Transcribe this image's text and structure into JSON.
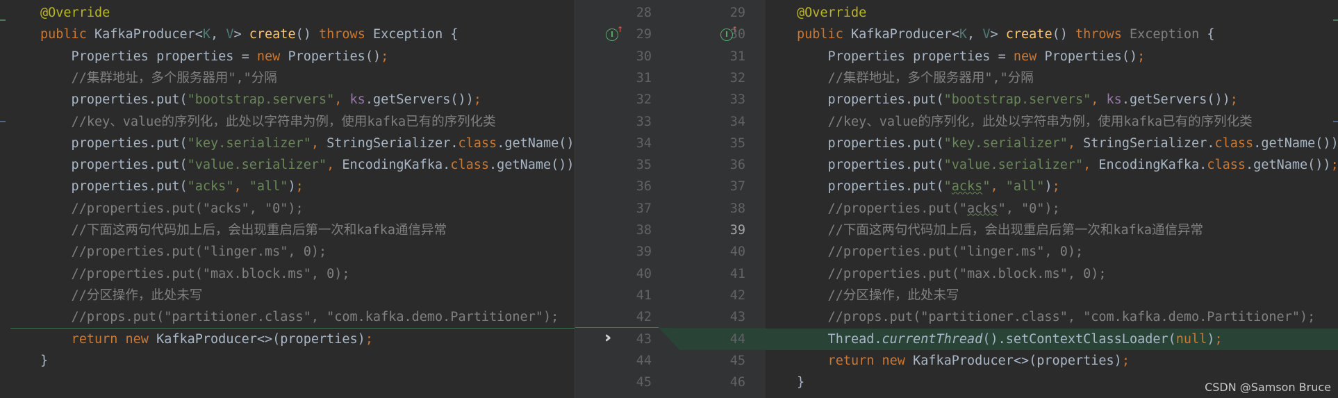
{
  "left": {
    "lines": [
      {
        "segs": [
          {
            "c": "ann",
            "t": "@Override"
          }
        ]
      },
      {
        "segs": [
          {
            "c": "kw",
            "t": "public "
          },
          {
            "c": "",
            "t": "KafkaProducer<"
          },
          {
            "c": "tp",
            "t": "K"
          },
          {
            "c": "",
            "t": ", "
          },
          {
            "c": "tp",
            "t": "V"
          },
          {
            "c": "",
            "t": "> "
          },
          {
            "c": "fn",
            "t": "create"
          },
          {
            "c": "",
            "t": "() "
          },
          {
            "c": "kw",
            "t": "throws "
          },
          {
            "c": "",
            "t": "Exception {"
          }
        ]
      },
      {
        "segs": [
          {
            "c": "",
            "t": "    Properties properties = "
          },
          {
            "c": "kw",
            "t": "new "
          },
          {
            "c": "",
            "t": "Properties()"
          },
          {
            "c": "kw",
            "t": ";"
          }
        ]
      },
      {
        "segs": [
          {
            "c": "cm",
            "t": "    //集群地址，多个服务器用\",\"分隔"
          }
        ]
      },
      {
        "segs": [
          {
            "c": "",
            "t": "    properties.put("
          },
          {
            "c": "str",
            "t": "\"bootstrap.servers\""
          },
          {
            "c": "kw",
            "t": ", "
          },
          {
            "c": "fld",
            "t": "ks"
          },
          {
            "c": "",
            "t": ".getServers())"
          },
          {
            "c": "kw",
            "t": ";"
          }
        ]
      },
      {
        "segs": [
          {
            "c": "cm",
            "t": "    //key、value的序列化，此处以字符串为例，使用kafka已有的序列化类"
          }
        ]
      },
      {
        "segs": [
          {
            "c": "",
            "t": "    properties.put("
          },
          {
            "c": "str",
            "t": "\"key.serializer\""
          },
          {
            "c": "kw",
            "t": ", "
          },
          {
            "c": "",
            "t": "StringSerializer."
          },
          {
            "c": "kw",
            "t": "class"
          },
          {
            "c": "",
            "t": ".getName())"
          }
        ]
      },
      {
        "segs": [
          {
            "c": "",
            "t": "    properties.put("
          },
          {
            "c": "str",
            "t": "\"value.serializer\""
          },
          {
            "c": "kw",
            "t": ", "
          },
          {
            "c": "",
            "t": "EncodingKafka."
          },
          {
            "c": "kw",
            "t": "class"
          },
          {
            "c": "",
            "t": ".getName())"
          },
          {
            "c": "kw",
            "t": ";"
          }
        ]
      },
      {
        "segs": [
          {
            "c": "",
            "t": "    properties.put("
          },
          {
            "c": "str",
            "t": "\"acks\""
          },
          {
            "c": "kw",
            "t": ", "
          },
          {
            "c": "str",
            "t": "\"all\""
          },
          {
            "c": "",
            "t": ")"
          },
          {
            "c": "kw",
            "t": ";"
          }
        ]
      },
      {
        "segs": [
          {
            "c": "cm",
            "t": "    //properties.put(\"acks\", \"0\");"
          }
        ]
      },
      {
        "segs": [
          {
            "c": "cm",
            "t": "    //下面这两句代码加上后，会出现重启后第一次和kafka通信异常"
          }
        ]
      },
      {
        "segs": [
          {
            "c": "cm",
            "t": "    //properties.put(\"linger.ms\", 0);"
          }
        ]
      },
      {
        "segs": [
          {
            "c": "cm",
            "t": "    //properties.put(\"max.block.ms\", 0);"
          }
        ]
      },
      {
        "segs": [
          {
            "c": "cm",
            "t": "    //分区操作，此处未写"
          }
        ]
      },
      {
        "segs": [
          {
            "c": "cm",
            "t": "    //props.put(\"partitioner.class\", \"com.kafka.demo.Partitioner\");"
          }
        ]
      },
      {
        "segs": [
          {
            "c": "kw",
            "t": "    return new "
          },
          {
            "c": "",
            "t": "KafkaProducer<>(properties)"
          },
          {
            "c": "kw",
            "t": ";"
          }
        ]
      },
      {
        "segs": [
          {
            "c": "",
            "t": "}"
          }
        ]
      },
      {
        "segs": [
          {
            "c": "",
            "t": ""
          }
        ]
      }
    ]
  },
  "gutter": {
    "left_numbers": [
      "28",
      "29",
      "30",
      "31",
      "32",
      "33",
      "34",
      "35",
      "36",
      "37",
      "38",
      "39",
      "40",
      "41",
      "42",
      "43",
      "44",
      "45"
    ],
    "right_numbers": [
      "29",
      "30",
      "31",
      "32",
      "33",
      "34",
      "35",
      "36",
      "37",
      "38",
      "39",
      "40",
      "41",
      "42",
      "43",
      "44",
      "45",
      "46"
    ],
    "highlighted_right_number": "39",
    "apply_icon": "double-chevron-right-icon"
  },
  "right": {
    "lines": [
      {
        "segs": [
          {
            "c": "ann",
            "t": "@Override"
          }
        ]
      },
      {
        "segs": [
          {
            "c": "kw",
            "t": "public "
          },
          {
            "c": "",
            "t": "KafkaProducer<"
          },
          {
            "c": "tp",
            "t": "K"
          },
          {
            "c": "",
            "t": ", "
          },
          {
            "c": "tp",
            "t": "V"
          },
          {
            "c": "",
            "t": "> "
          },
          {
            "c": "fn",
            "t": "create"
          },
          {
            "c": "",
            "t": "() "
          },
          {
            "c": "kw",
            "t": "throws "
          },
          {
            "c": "grey",
            "t": "Exception "
          },
          {
            "c": "",
            "t": "{"
          }
        ]
      },
      {
        "segs": [
          {
            "c": "",
            "t": "    Properties properties = "
          },
          {
            "c": "kw",
            "t": "new "
          },
          {
            "c": "",
            "t": "Properties()"
          },
          {
            "c": "kw",
            "t": ";"
          }
        ]
      },
      {
        "segs": [
          {
            "c": "cm",
            "t": "    //集群地址，多个服务器用\",\"分隔"
          }
        ]
      },
      {
        "segs": [
          {
            "c": "",
            "t": "    properties.put("
          },
          {
            "c": "str",
            "t": "\"bootstrap.servers\""
          },
          {
            "c": "kw",
            "t": ", "
          },
          {
            "c": "fld",
            "t": "ks"
          },
          {
            "c": "",
            "t": ".getServers())"
          },
          {
            "c": "kw",
            "t": ";"
          }
        ]
      },
      {
        "segs": [
          {
            "c": "cm",
            "t": "    //key、value的序列化，此处以字符串为例，使用kafka已有的序列化类"
          }
        ]
      },
      {
        "segs": [
          {
            "c": "",
            "t": "    properties.put("
          },
          {
            "c": "str",
            "t": "\"key.serializer\""
          },
          {
            "c": "kw",
            "t": ", "
          },
          {
            "c": "",
            "t": "StringSerializer."
          },
          {
            "c": "kw",
            "t": "class"
          },
          {
            "c": "",
            "t": ".getName())"
          },
          {
            "c": "kw",
            "t": ";"
          }
        ]
      },
      {
        "segs": [
          {
            "c": "",
            "t": "    properties.put("
          },
          {
            "c": "str",
            "t": "\"value.serializer\""
          },
          {
            "c": "kw",
            "t": ", "
          },
          {
            "c": "",
            "t": "EncodingKafka."
          },
          {
            "c": "kw",
            "t": "class"
          },
          {
            "c": "",
            "t": ".getName())"
          },
          {
            "c": "kw",
            "t": ";"
          }
        ]
      },
      {
        "segs": [
          {
            "c": "",
            "t": "    properties.put("
          },
          {
            "c": "str",
            "t": "\""
          },
          {
            "c": "str typo",
            "t": "acks"
          },
          {
            "c": "str",
            "t": "\""
          },
          {
            "c": "kw",
            "t": ", "
          },
          {
            "c": "str",
            "t": "\"all\""
          },
          {
            "c": "",
            "t": ")"
          },
          {
            "c": "kw",
            "t": ";"
          }
        ]
      },
      {
        "segs": [
          {
            "c": "cm",
            "t": "    //properties.put(\""
          },
          {
            "c": "cm typo",
            "t": "acks"
          },
          {
            "c": "cm",
            "t": "\", \"0\");"
          }
        ]
      },
      {
        "segs": [
          {
            "c": "cm",
            "t": "    //下面这两句代码加上后，会出现重启后第一次和kafka通信异常"
          }
        ]
      },
      {
        "segs": [
          {
            "c": "cm",
            "t": "    //properties.put(\"linger.ms\", 0);"
          }
        ]
      },
      {
        "segs": [
          {
            "c": "cm",
            "t": "    //properties.put(\"max.block.ms\", 0);"
          }
        ]
      },
      {
        "segs": [
          {
            "c": "cm",
            "t": "    //分区操作，此处未写"
          }
        ]
      },
      {
        "segs": [
          {
            "c": "cm",
            "t": "    //props.put(\"partitioner.class\", \"com.kafka.demo.Partitioner\");"
          }
        ]
      },
      {
        "segs": [
          {
            "c": "",
            "t": "    Thread."
          },
          {
            "c": "ital",
            "t": "currentThread"
          },
          {
            "c": "",
            "t": "().setContextClassLoader("
          },
          {
            "c": "kw",
            "t": "null"
          },
          {
            "c": "",
            "t": ")"
          },
          {
            "c": "kw",
            "t": ";"
          }
        ]
      },
      {
        "segs": [
          {
            "c": "kw",
            "t": "    return new "
          },
          {
            "c": "",
            "t": "KafkaProducer<>(properties)"
          },
          {
            "c": "kw",
            "t": ";"
          }
        ]
      },
      {
        "segs": [
          {
            "c": "",
            "t": "}"
          }
        ]
      }
    ]
  },
  "watermark": "CSDN @Samson Bruce"
}
